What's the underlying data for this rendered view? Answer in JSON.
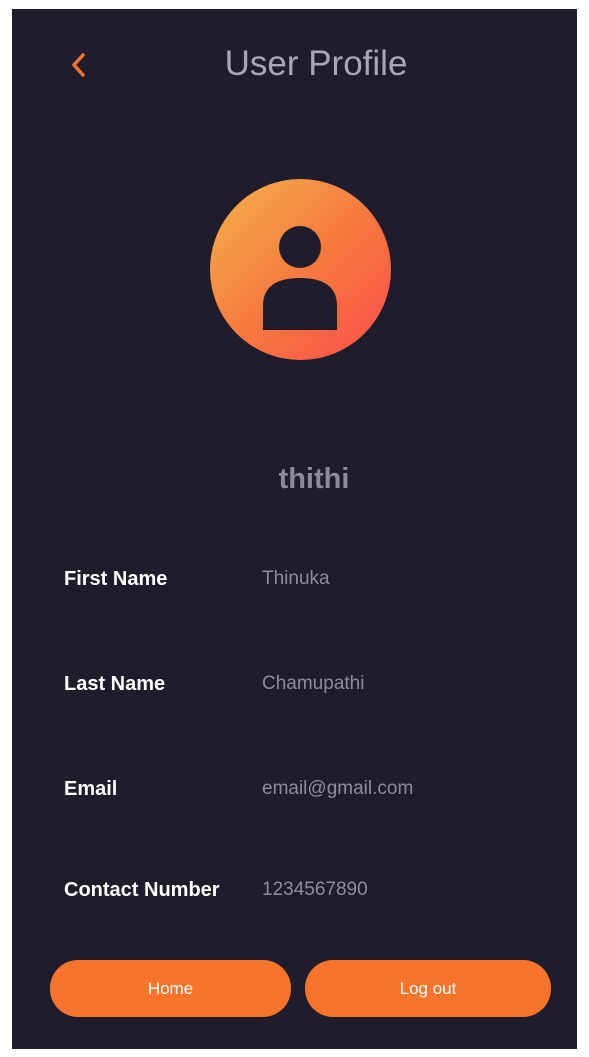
{
  "header": {
    "title": "User Profile",
    "back_icon": "chevron-left-icon"
  },
  "profile": {
    "avatar_icon": "user-icon",
    "username": "thithi",
    "fields": [
      {
        "label": "First Name",
        "value": "Thinuka"
      },
      {
        "label": "Last Name",
        "value": "Chamupathi"
      },
      {
        "label": "Email",
        "value": "email@gmail.com"
      },
      {
        "label": "Contact Number",
        "value": "1234567890"
      }
    ]
  },
  "actions": {
    "home_label": "Home",
    "logout_label": "Log out"
  },
  "colors": {
    "background": "#1f1d2b",
    "accent": "#f7742a",
    "label": "#ffffff",
    "muted": "#8e8c97"
  }
}
